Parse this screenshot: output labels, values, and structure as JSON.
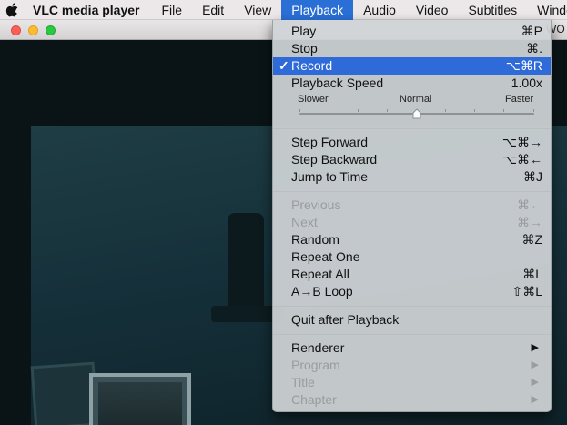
{
  "menubar": {
    "app_name": "VLC media player",
    "items": [
      "File",
      "Edit",
      "View",
      "Playback",
      "Audio",
      "Video",
      "Subtitles",
      "Window"
    ],
    "active_item": "Playback"
  },
  "window": {
    "title_fragment": "WO"
  },
  "menu": {
    "play": {
      "label": "Play",
      "shortcut": "⌘P"
    },
    "stop": {
      "label": "Stop",
      "shortcut": "⌘."
    },
    "record": {
      "label": "Record",
      "shortcut": "⌥⌘R",
      "check": "✓",
      "checked": true
    },
    "playback_speed": {
      "label": "Playback Speed",
      "value": "1.00x",
      "slower_label": "Slower",
      "normal_label": "Normal",
      "faster_label": "Faster",
      "slider_level": 0.5
    },
    "step_forward": {
      "label": "Step Forward",
      "shortcut": "⌥⌘→"
    },
    "step_backward": {
      "label": "Step Backward",
      "shortcut": "⌥⌘←"
    },
    "jump_to_time": {
      "label": "Jump to Time",
      "shortcut": "⌘J"
    },
    "previous": {
      "label": "Previous",
      "shortcut": "⌘←",
      "enabled": false
    },
    "next": {
      "label": "Next",
      "shortcut": "⌘→",
      "enabled": false
    },
    "random": {
      "label": "Random",
      "shortcut": "⌘Z"
    },
    "repeat_one": {
      "label": "Repeat One",
      "shortcut": ""
    },
    "repeat_all": {
      "label": "Repeat All",
      "shortcut": "⌘L"
    },
    "ab_loop": {
      "label": "A→B Loop",
      "shortcut": "⇧⌘L"
    },
    "quit_after_playback": {
      "label": "Quit after Playback"
    },
    "renderer": {
      "label": "Renderer",
      "submenu": true
    },
    "program": {
      "label": "Program",
      "submenu": true,
      "enabled": false
    },
    "title": {
      "label": "Title",
      "submenu": true,
      "enabled": false
    },
    "chapter": {
      "label": "Chapter",
      "submenu": true,
      "enabled": false
    }
  },
  "icons": {
    "apple": "apple-logo-icon",
    "submenu_arrow": "▶"
  },
  "colors": {
    "highlight": "#2e6bd8",
    "menubar_active": "#2a6fd6",
    "close": "#fc5f57",
    "minimize": "#fdbc2e",
    "zoom": "#28c840"
  }
}
